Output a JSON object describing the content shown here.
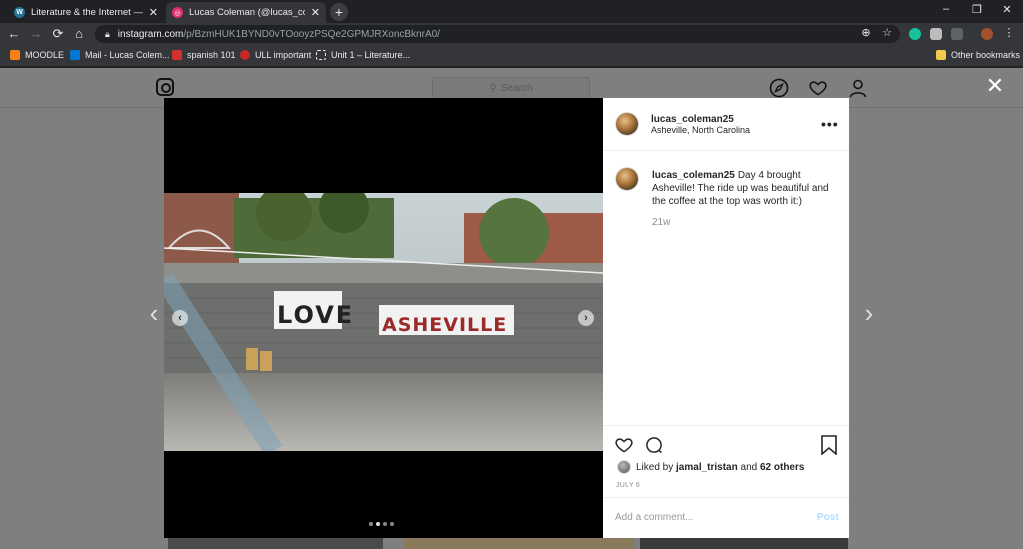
{
  "browser": {
    "tabs": [
      {
        "title": "Literature & the Internet — Word",
        "active": false,
        "favicon": "wordpress-icon",
        "color": "#21759b"
      },
      {
        "title": "Lucas Coleman (@lucas_coleman",
        "active": true,
        "favicon": "instagram-icon",
        "color": "#e1306c"
      }
    ],
    "new_tab_label": "+",
    "window_controls": {
      "minimize": "–",
      "maximize": "❐",
      "close": "✕"
    },
    "nav": {
      "back": "←",
      "forward": "→",
      "reload": "⟳",
      "home": "⌂"
    },
    "url": {
      "host": "instagram.com",
      "path": "/p/BzmHUK1BYND0vTOooyzPSQe2GPMJRXoncBknrA0/"
    },
    "omnibox_icons": {
      "zoom": "⊕",
      "star": "☆",
      "menu": "⋮"
    },
    "bookmarks": [
      {
        "label": "MOODLE",
        "color": "#f98012"
      },
      {
        "label": "Mail - Lucas Colem...",
        "color": "#0078d4"
      },
      {
        "label": "spanish 101",
        "color": "#d32f2f"
      },
      {
        "label": "ULL important",
        "color": "#c62828"
      },
      {
        "label": "Unit 1 – Literature...",
        "color": "#e8eaed"
      }
    ],
    "other_bookmarks": "Other bookmarks"
  },
  "instagram": {
    "search_placeholder": "Search",
    "close_label": "✕",
    "prev_label": "‹",
    "next_label": "›",
    "post": {
      "username": "lucas_coleman25",
      "location": "Asheville, North Carolina",
      "more_label": "•••",
      "caption_user": "lucas_coleman25",
      "caption_text": "Day 4 brought Asheville! The ride up was beautiful and the coffee at the top was worth it:)",
      "age": "21w",
      "liked_by_prefix": "Liked by ",
      "liked_by_user": "jamal_tristan",
      "liked_by_mid": " and ",
      "liked_by_count": "62 others",
      "date": "JULY 6",
      "comment_placeholder": "Add a comment...",
      "post_label": "Post",
      "photo_sign_text": "LOVE ASHEVILLE",
      "carousel": {
        "count": 4,
        "active_index": 1
      }
    }
  }
}
